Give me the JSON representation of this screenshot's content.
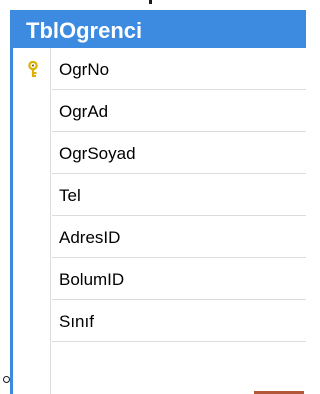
{
  "table": {
    "title": "TblOgrenci",
    "columns": [
      {
        "name": "OgrNo",
        "primary_key": true
      },
      {
        "name": "OgrAd",
        "primary_key": false
      },
      {
        "name": "OgrSoyad",
        "primary_key": false
      },
      {
        "name": "Tel",
        "primary_key": false
      },
      {
        "name": "AdresID",
        "primary_key": false
      },
      {
        "name": "BolumID",
        "primary_key": false
      },
      {
        "name": "Sınıf",
        "primary_key": false
      }
    ]
  },
  "colors": {
    "header_blue": "#3d8be0",
    "key_gold": "#e0b000",
    "relationship_line": "#b2573a"
  },
  "icons": {
    "primary_key": "key-icon"
  }
}
